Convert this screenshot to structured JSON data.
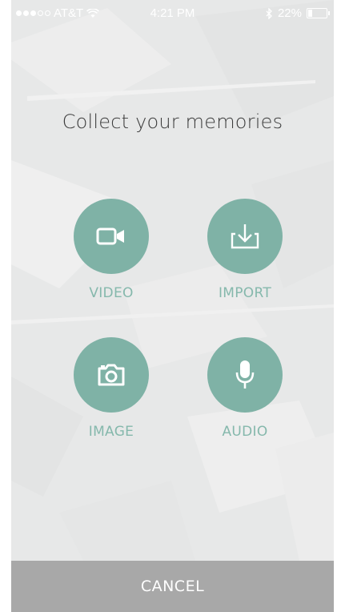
{
  "status_bar": {
    "carrier": "AT&T",
    "time": "4:21 PM",
    "battery": "22%",
    "battery_level": 0.22,
    "signal_bars": 3,
    "signal_total": 5
  },
  "heading": "Collect your memories",
  "options": [
    {
      "label": "VIDEO",
      "icon": "video-camera-icon"
    },
    {
      "label": "IMPORT",
      "icon": "import-tray-icon"
    },
    {
      "label": "IMAGE",
      "icon": "camera-icon"
    },
    {
      "label": "AUDIO",
      "icon": "microphone-icon"
    }
  ],
  "cancel_label": "CANCEL",
  "colors": {
    "accent": "#7fb2a6",
    "label": "#85b8ac",
    "background": "#e9eaea",
    "cancel_bar": "#a8a8a8",
    "heading_text": "#3b3b3b"
  }
}
